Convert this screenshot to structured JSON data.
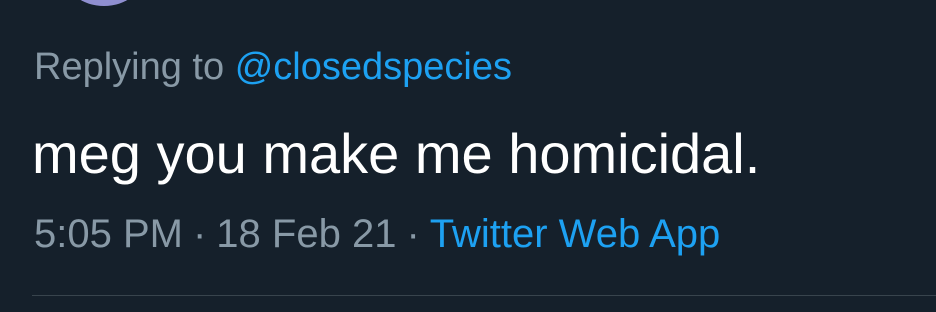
{
  "tweet": {
    "reply_prefix": "Replying to",
    "reply_handle": "@closedspecies",
    "text": "meg you make me homicidal.",
    "time": "5:05 PM",
    "separator": "·",
    "date": "18 Feb 21",
    "source": "Twitter Web App"
  },
  "colors": {
    "background": "#15202b",
    "text": "#ffffff",
    "muted": "#8899a6",
    "accent": "#1da1f2",
    "divider": "#38444d"
  }
}
